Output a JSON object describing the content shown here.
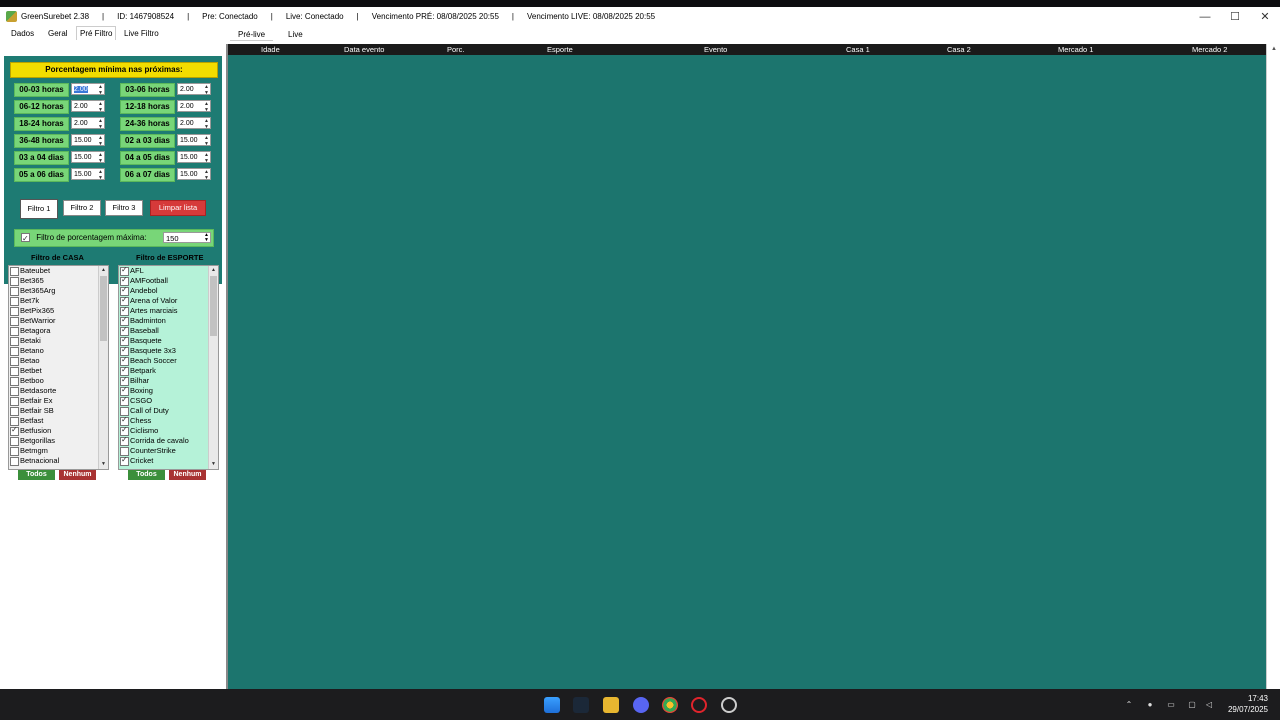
{
  "titlebar": {
    "app_name": "GreenSurebet 2.38",
    "id": "ID: 1467908524",
    "pre_status": "Pre: Conectado",
    "live_status": "Live: Conectado",
    "venc_pre": "Vencimento PRÉ: 08/08/2025 20:55",
    "venc_live": "Vencimento LIVE: 08/08/2025 20:55",
    "sep": "|",
    "minimize": "—",
    "maximize": "☐",
    "close": "✕"
  },
  "menu": [
    "Dados",
    "Geral",
    "Pré Filtro",
    "Live Filtro"
  ],
  "main_tabs": [
    "Pré-live",
    "Live"
  ],
  "pct_header": "Porcentagem mínima nas próximas:",
  "hours": [
    {
      "label": "00-03 horas",
      "value": "2.00"
    },
    {
      "label": "03-06 horas",
      "value": "2.00"
    },
    {
      "label": "06-12 horas",
      "value": "2.00"
    },
    {
      "label": "12-18 horas",
      "value": "2.00"
    },
    {
      "label": "18-24 horas",
      "value": "2.00"
    },
    {
      "label": "24-36 horas",
      "value": "2.00"
    },
    {
      "label": "36-48 horas",
      "value": "15.00"
    },
    {
      "label": "02 a 03 dias",
      "value": "15.00"
    },
    {
      "label": "03 a 04 dias",
      "value": "15.00"
    },
    {
      "label": "04 a 05 dias",
      "value": "15.00"
    },
    {
      "label": "05 a 06 dias",
      "value": "15.00"
    },
    {
      "label": "06 a 07 dias",
      "value": "15.00"
    }
  ],
  "filter_buttons": [
    "Filtro 1",
    "Filtro 2",
    "Filtro 3"
  ],
  "clear_button": "Limpar lista",
  "max_filter": {
    "label": "Filtro de porcentagem máxima:",
    "value": "150",
    "checked": true
  },
  "casa": {
    "title": "Filtro de CASA",
    "items": [
      {
        "label": "Bateubet",
        "checked": false
      },
      {
        "label": "Bet365",
        "checked": false
      },
      {
        "label": "Bet365Arg",
        "checked": false
      },
      {
        "label": "Bet7k",
        "checked": false
      },
      {
        "label": "BetPix365",
        "checked": false
      },
      {
        "label": "BetWarrior",
        "checked": false
      },
      {
        "label": "Betagora",
        "checked": false
      },
      {
        "label": "Betaki",
        "checked": false
      },
      {
        "label": "Betano",
        "checked": false
      },
      {
        "label": "Betao",
        "checked": false
      },
      {
        "label": "Betbet",
        "checked": false
      },
      {
        "label": "Betboo",
        "checked": false
      },
      {
        "label": "Betdasorte",
        "checked": false
      },
      {
        "label": "Betfair Ex",
        "checked": false
      },
      {
        "label": "Betfair SB",
        "checked": false
      },
      {
        "label": "Betfast",
        "checked": false
      },
      {
        "label": "Betfusion",
        "checked": true
      },
      {
        "label": "Betgorillas",
        "checked": false
      },
      {
        "label": "Betmgm",
        "checked": false
      },
      {
        "label": "Betnacional",
        "checked": false
      }
    ]
  },
  "esporte": {
    "title": "Filtro de ESPORTE",
    "items": [
      {
        "label": "AFL",
        "checked": true
      },
      {
        "label": "AMFootball",
        "checked": true
      },
      {
        "label": "Andebol",
        "checked": true
      },
      {
        "label": "Arena of Valor",
        "checked": true
      },
      {
        "label": "Artes marciais",
        "checked": true
      },
      {
        "label": "Badminton",
        "checked": true
      },
      {
        "label": "Baseball",
        "checked": true
      },
      {
        "label": "Basquete",
        "checked": true
      },
      {
        "label": "Basquete 3x3",
        "checked": true
      },
      {
        "label": "Beach Soccer",
        "checked": true
      },
      {
        "label": "Betpark",
        "checked": true
      },
      {
        "label": "Bilhar",
        "checked": true
      },
      {
        "label": "Boxing",
        "checked": true
      },
      {
        "label": "CSGO",
        "checked": true
      },
      {
        "label": "Call of Duty",
        "checked": false
      },
      {
        "label": "Chess",
        "checked": true
      },
      {
        "label": "Ciclismo",
        "checked": true
      },
      {
        "label": "Corrida de cavalo",
        "checked": true
      },
      {
        "label": "CounterStrike",
        "checked": false
      },
      {
        "label": "Cricket",
        "checked": true
      }
    ]
  },
  "list_buttons": {
    "todos": "Todos",
    "nenhum": "Nenhum"
  },
  "columns": [
    "Idade",
    "Data evento",
    "Porc.",
    "Esporte",
    "Evento",
    "Casa 1",
    "Casa 2",
    "Mercado 1",
    "Mercado 2"
  ],
  "clock": {
    "time": "17:43",
    "date": "29/07/2025"
  },
  "colors": {
    "grid_bg": "#1c756e",
    "panel_bg": "#1e7b73",
    "label_green": "#78d678",
    "header_yellow": "#f2dd00",
    "clear_red": "#d63a3a"
  }
}
